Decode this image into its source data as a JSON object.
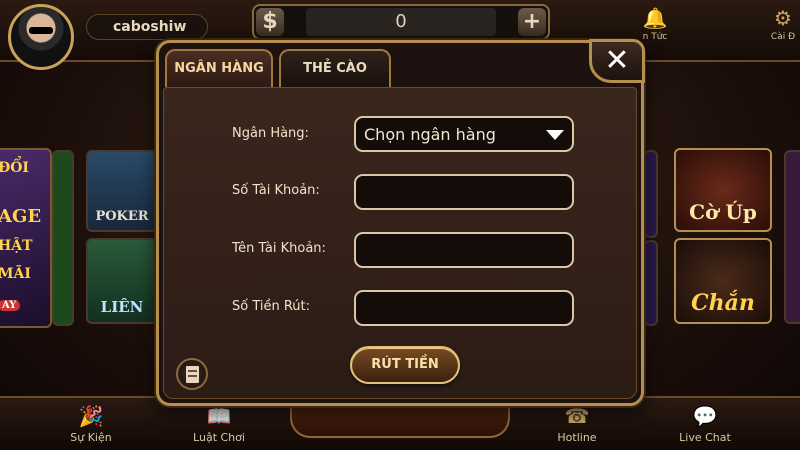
{
  "header": {
    "username": "caboshiw",
    "balance": "0",
    "currency_symbol": "$",
    "add_symbol": "+",
    "top_icons": [
      {
        "label": "n Tức",
        "icon": "bell-icon"
      },
      {
        "label": "Cài Đ",
        "icon": "gear-icon"
      }
    ]
  },
  "background_tiles": {
    "banner_lines": [
      "ĐỔI",
      "AGE",
      "HẬT",
      "MÃI",
      "AY"
    ],
    "poker": "POKER",
    "lieng": "LIÊN",
    "coup": "Cờ Úp",
    "chan": "Chắn"
  },
  "bottom_nav": [
    {
      "label": "Sự Kiện",
      "icon": "party-popper-icon"
    },
    {
      "label": "Luật Chơi",
      "icon": "rules-book-icon"
    },
    {
      "label": "Hotline",
      "icon": "phone-icon"
    },
    {
      "label": "Live Chat",
      "icon": "chat-bubble-icon"
    }
  ],
  "modal": {
    "tabs": [
      {
        "label": "NGÂN HÀNG",
        "active": true
      },
      {
        "label": "THẺ CÀO",
        "active": false
      }
    ],
    "close_symbol": "✕",
    "form": {
      "bank_label": "Ngân Hàng:",
      "bank_select_value": "Chọn ngân hàng",
      "account_number_label": "Số Tài Khoản:",
      "account_number_value": "",
      "account_name_label": "Tên Tài Khoản:",
      "account_name_value": "",
      "amount_label": "Số Tiền Rút:",
      "amount_value": ""
    },
    "submit_label": "RÚT TIỀN"
  },
  "colors": {
    "accent_gold": "#b58f4d",
    "panel_brown": "#3a261d",
    "text_cream": "#f1e3c8"
  }
}
